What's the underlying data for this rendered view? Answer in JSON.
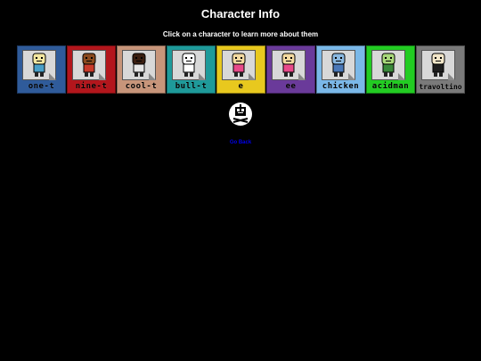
{
  "page": {
    "title": "Character Info",
    "subtitle": "Click on a character to learn more about them",
    "back_link": "Go Back"
  },
  "characters": [
    {
      "label": "one-t",
      "bg": "#2f5b9a",
      "skin": "#f2e6a0",
      "body": "#4aa0c8",
      "icon": "one-t-character-icon"
    },
    {
      "label": "nine-t",
      "bg": "#b3161c",
      "skin": "#8a4a1e",
      "body": "#c93a2a",
      "icon": "nine-t-character-icon"
    },
    {
      "label": "cool-t",
      "bg": "#c7957a",
      "skin": "#3a1e10",
      "body": "#e6e6e6",
      "icon": "cool-t-character-icon"
    },
    {
      "label": "bull-t",
      "bg": "#1e9a9a",
      "skin": "#ffffff",
      "body": "#ffffff",
      "icon": "bull-t-character-icon"
    },
    {
      "label": "e",
      "bg": "#e8c81e",
      "skin": "#f2d9a0",
      "body": "#e84a8a",
      "icon": "e-character-icon"
    },
    {
      "label": "ee",
      "bg": "#6a3a9a",
      "skin": "#f2d9a0",
      "body": "#e84a8a",
      "icon": "ee-character-icon"
    },
    {
      "label": "chicken",
      "bg": "#7ab8e8",
      "skin": "#8ab8e0",
      "body": "#4a78b8",
      "icon": "chicken-character-icon"
    },
    {
      "label": "acidman",
      "bg": "#22cc22",
      "skin": "#a8d87a",
      "body": "#3a8a3a",
      "icon": "acidman-character-icon"
    },
    {
      "label": "travoltino",
      "bg": "#7a7a7a",
      "skin": "#f2e6c8",
      "body": "#1e1e1e",
      "icon": "travoltino-character-icon"
    }
  ]
}
